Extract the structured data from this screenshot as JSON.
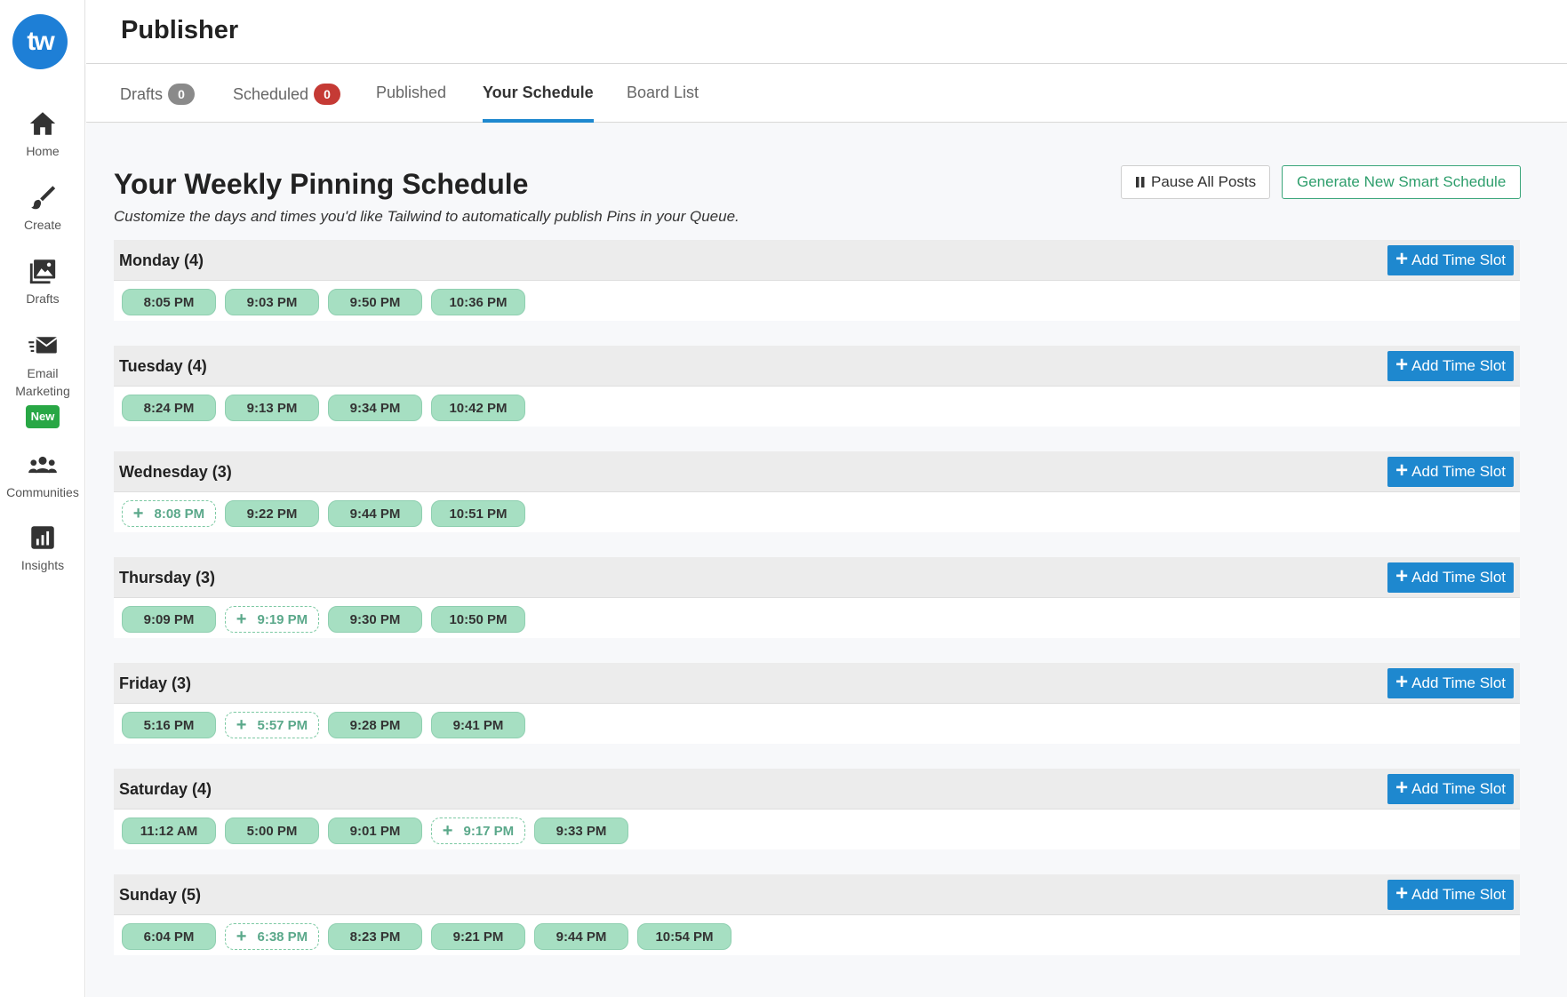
{
  "app": {
    "logo_text": "tw",
    "title": "Publisher"
  },
  "sidebar": {
    "items": [
      {
        "label": "Home",
        "icon": "home-icon"
      },
      {
        "label": "Create",
        "icon": "brush-icon"
      },
      {
        "label": "Drafts",
        "icon": "image-icon"
      },
      {
        "label": "Email Marketing",
        "icon": "envelope-icon",
        "badge": "New"
      },
      {
        "label": "Communities",
        "icon": "users-icon"
      },
      {
        "label": "Insights",
        "icon": "chart-icon"
      }
    ]
  },
  "tabs": [
    {
      "label": "Drafts",
      "count": "0"
    },
    {
      "label": "Scheduled",
      "count": "0"
    },
    {
      "label": "Published"
    },
    {
      "label": "Your Schedule",
      "active": true
    },
    {
      "label": "Board List"
    }
  ],
  "schedule": {
    "title": "Your Weekly Pinning Schedule",
    "subtitle": "Customize the days and times you'd like Tailwind to automatically publish Pins in your Queue.",
    "pause_label": "Pause All Posts",
    "generate_label": "Generate New Smart Schedule",
    "add_slot_label": "Add Time Slot",
    "days": [
      {
        "name": "Monday (4)",
        "slots": [
          {
            "time": "8:05 PM"
          },
          {
            "time": "9:03 PM"
          },
          {
            "time": "9:50 PM"
          },
          {
            "time": "10:36 PM"
          }
        ]
      },
      {
        "name": "Tuesday (4)",
        "slots": [
          {
            "time": "8:24 PM"
          },
          {
            "time": "9:13 PM"
          },
          {
            "time": "9:34 PM"
          },
          {
            "time": "10:42 PM"
          }
        ]
      },
      {
        "name": "Wednesday (3)",
        "slots": [
          {
            "time": "8:08 PM",
            "empty": true
          },
          {
            "time": "9:22 PM"
          },
          {
            "time": "9:44 PM"
          },
          {
            "time": "10:51 PM"
          }
        ]
      },
      {
        "name": "Thursday (3)",
        "slots": [
          {
            "time": "9:09 PM"
          },
          {
            "time": "9:19 PM",
            "empty": true
          },
          {
            "time": "9:30 PM"
          },
          {
            "time": "10:50 PM"
          }
        ]
      },
      {
        "name": "Friday (3)",
        "slots": [
          {
            "time": "5:16 PM"
          },
          {
            "time": "5:57 PM",
            "empty": true
          },
          {
            "time": "9:28 PM"
          },
          {
            "time": "9:41 PM"
          }
        ]
      },
      {
        "name": "Saturday (4)",
        "slots": [
          {
            "time": "11:12 AM"
          },
          {
            "time": "5:00 PM"
          },
          {
            "time": "9:01 PM"
          },
          {
            "time": "9:17 PM",
            "empty": true
          },
          {
            "time": "9:33 PM"
          }
        ]
      },
      {
        "name": "Sunday (5)",
        "slots": [
          {
            "time": "6:04 PM"
          },
          {
            "time": "6:38 PM",
            "empty": true
          },
          {
            "time": "8:23 PM"
          },
          {
            "time": "9:21 PM"
          },
          {
            "time": "9:44 PM"
          },
          {
            "time": "10:54 PM"
          }
        ]
      }
    ]
  },
  "colors": {
    "brand_blue": "#1e88cf",
    "slot_green": "#a6dfc2",
    "badge_red": "#c53a35",
    "badge_new_green": "#28a745"
  }
}
